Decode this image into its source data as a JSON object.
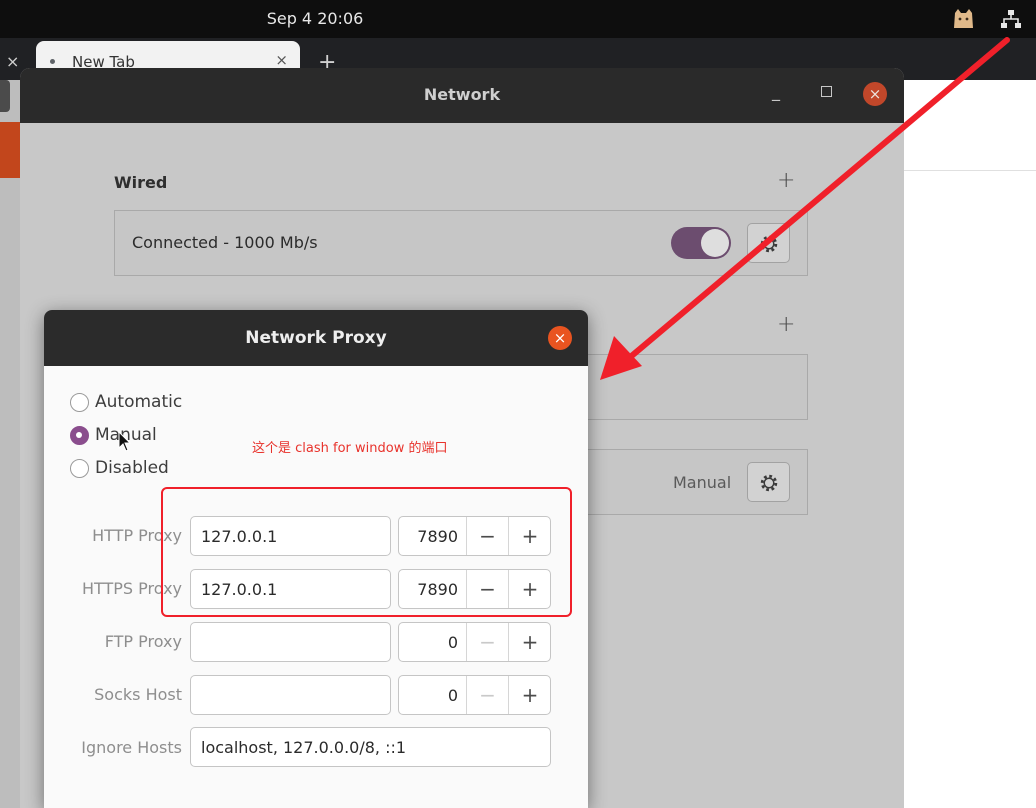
{
  "topbar": {
    "datetime": "Sep 4  20:06",
    "tray_icons": [
      "cat-icon",
      "network-icon"
    ]
  },
  "browser": {
    "tab_title": "New Tab",
    "tab_close": "×",
    "left_tab_close": "×",
    "new_tab": "+"
  },
  "network_window": {
    "title": "Network",
    "controls": {
      "minimize": "_",
      "close": "×"
    },
    "wired": {
      "title": "Wired",
      "add": "+",
      "status": "Connected - 1000 Mb/s",
      "enabled": true
    },
    "vpn_add": "+",
    "proxy_row": {
      "state": "Manual"
    }
  },
  "proxy_dialog": {
    "title": "Network Proxy",
    "close": "×",
    "methods": [
      {
        "label": "Automatic",
        "checked": false
      },
      {
        "label": "Manual",
        "checked": true
      },
      {
        "label": "Disabled",
        "checked": false
      }
    ],
    "fields": {
      "http": {
        "label": "HTTP Proxy",
        "host": "127.0.0.1",
        "port": "7890"
      },
      "https": {
        "label": "HTTPS Proxy",
        "host": "127.0.0.1",
        "port": "7890"
      },
      "ftp": {
        "label": "FTP Proxy",
        "host": "",
        "port": "0"
      },
      "socks": {
        "label": "Socks Host",
        "host": "",
        "port": "0"
      },
      "ignore": {
        "label": "Ignore Hosts",
        "value": "localhost, 127.0.0.0/8, ::1"
      }
    },
    "stepper": {
      "minus": "−",
      "plus": "+"
    }
  },
  "annotation": {
    "text": "这个是 clash for window 的端口",
    "color": "#f0202a"
  },
  "colors": {
    "accent_orange": "#e95420",
    "toggle_purple": "#6c4d6f",
    "radio_purple": "#8a4d8d"
  }
}
